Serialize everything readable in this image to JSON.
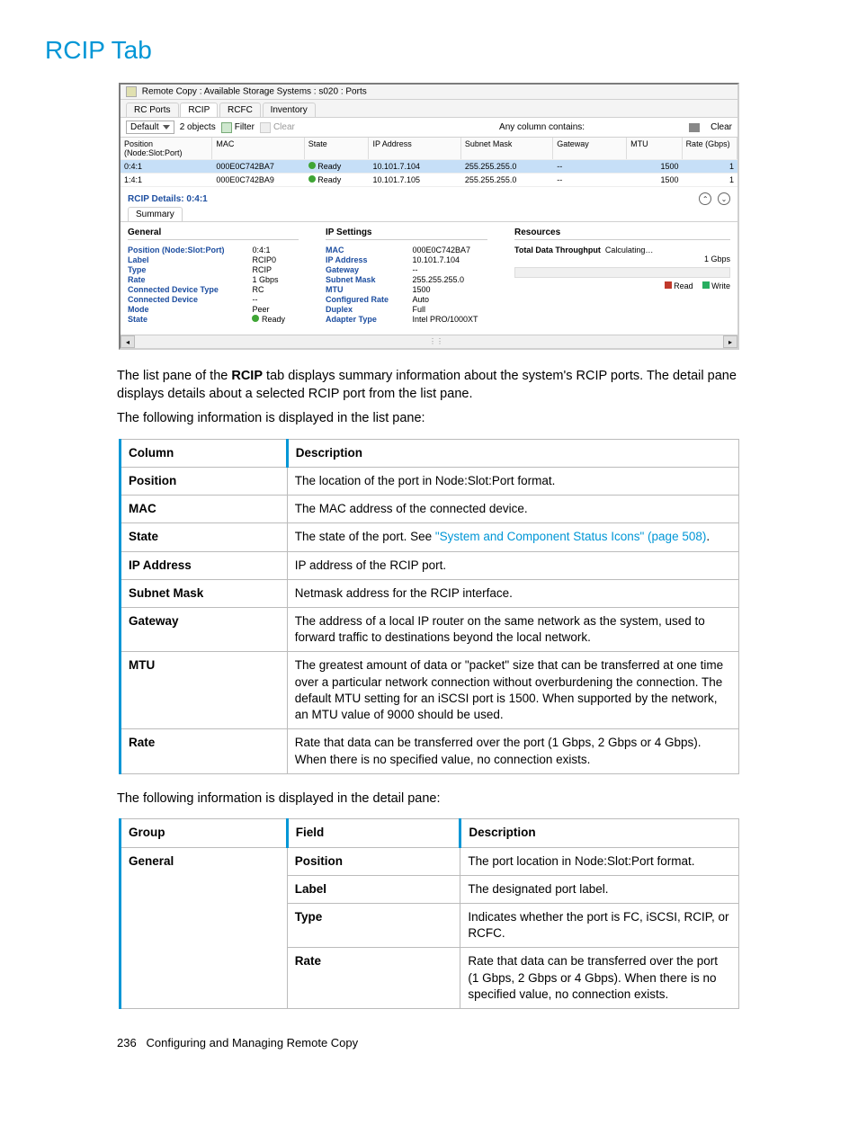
{
  "page_title": "RCIP Tab",
  "screenshot": {
    "window_title": "Remote Copy : Available Storage Systems : s020 : Ports",
    "tabs": [
      "RC Ports",
      "RCIP",
      "RCFC",
      "Inventory"
    ],
    "active_tab": "RCIP",
    "filter_box": "Default",
    "object_count": "2 objects",
    "filter_label": "Filter",
    "clear_label": "Clear",
    "any_col": "Any column contains:",
    "clear_btn": "Clear",
    "columns": [
      "Position (Node:Slot:Port)",
      "MAC",
      "State",
      "IP Address",
      "Subnet Mask",
      "Gateway",
      "MTU",
      "Rate (Gbps)"
    ],
    "rows": [
      {
        "pos": "0:4:1",
        "mac": "000E0C742BA7",
        "state": "Ready",
        "ip": "10.101.7.104",
        "mask": "255.255.255.0",
        "gw": "--",
        "mtu": "1500",
        "rate": "1",
        "sel": true
      },
      {
        "pos": "1:4:1",
        "mac": "000E0C742BA9",
        "state": "Ready",
        "ip": "10.101.7.105",
        "mask": "255.255.255.0",
        "gw": "--",
        "mtu": "1500",
        "rate": "1",
        "sel": false
      }
    ],
    "details_title": "RCIP Details: 0:4:1",
    "sub_tab": "Summary",
    "general": {
      "title": "General",
      "Position (Node:Slot:Port)": "0:4:1",
      "Label": "RCIP0",
      "Type": "RCIP",
      "Rate": "1 Gbps",
      "Connected Device Type": "RC",
      "Connected Device": "--",
      "Mode": "Peer",
      "State": "Ready"
    },
    "ip": {
      "title": "IP Settings",
      "MAC": "000E0C742BA7",
      "IP Address": "10.101.7.104",
      "Gateway": "--",
      "Subnet Mask": "255.255.255.0",
      "MTU": "1500",
      "Configured Rate": "Auto",
      "Duplex": "Full",
      "Adapter Type": "Intel PRO/1000XT"
    },
    "resources": {
      "title": "Resources",
      "thruput_label": "Total Data Throughput",
      "thruput_val": "Calculating…",
      "max": "1 Gbps",
      "legend_read": "Read",
      "legend_write": "Write"
    }
  },
  "para1a": "The list pane of the ",
  "para1b": "RCIP",
  "para1c": " tab displays summary information about the system's RCIP ports. The detail pane displays details about a selected RCIP port from the list pane.",
  "para2": "The following information is displayed in the list pane:",
  "table1": {
    "head": [
      "Column",
      "Description"
    ],
    "rows": [
      [
        "Position",
        "The location of the port in Node:Slot:Port format."
      ],
      [
        "MAC",
        "The MAC address of the connected device."
      ],
      [
        "State",
        {
          "pre": "The state of the port. See ",
          "link": "\"System and Component Status Icons\" (page 508)",
          "post": "."
        }
      ],
      [
        "IP Address",
        "IP address of the RCIP port."
      ],
      [
        "Subnet Mask",
        "Netmask address for the RCIP interface."
      ],
      [
        "Gateway",
        "The address of a local IP router on the same network as the system, used to forward traffic to destinations beyond the local network."
      ],
      [
        "MTU",
        "The greatest amount of data or \"packet\" size that can be transferred at one time over a particular network connection without overburdening the connection. The default MTU setting for an iSCSI port is 1500. When supported by the network, an MTU value of 9000 should be used."
      ],
      [
        "Rate",
        "Rate that data can be transferred over the port (1 Gbps, 2 Gbps or 4 Gbps). When there is no specified value, no connection exists."
      ]
    ]
  },
  "para3": "The following information is displayed in the detail pane:",
  "table2": {
    "head": [
      "Group",
      "Field",
      "Description"
    ],
    "rows": [
      [
        "General",
        "Position",
        "The port location in Node:Slot:Port format."
      ],
      [
        "",
        "Label",
        "The designated port label."
      ],
      [
        "",
        "Type",
        "Indicates whether the port is FC, iSCSI, RCIP, or RCFC."
      ],
      [
        "",
        "Rate",
        "Rate that data can be transferred over the port (1 Gbps, 2 Gbps or 4 Gbps). When there is no specified value, no connection exists."
      ]
    ]
  },
  "footer_num": "236",
  "footer_text": "Configuring and Managing Remote Copy"
}
